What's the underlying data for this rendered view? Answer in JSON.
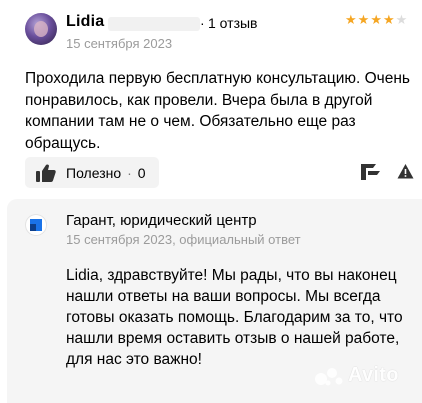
{
  "review": {
    "author": "Lidia",
    "reviews_count": "1 отзыв",
    "rating": 4,
    "max_rating": 5,
    "date": "15 сентября 2023",
    "text": "Проходила первую бесплатную консультацию. Очень понравилось, как провели. Вчера была в другой компании там не о чем. Обязательно еще раз обращусь.",
    "useful_label": "Полезно",
    "useful_separator": "·",
    "useful_count": "0"
  },
  "reply": {
    "company": "Гарант, юридический центр",
    "meta": "15 сентября 2023, официальный ответ",
    "text": "Lidia, здравствуйте! Мы рады, что вы наконец нашли ответы на ваши вопросы. Мы всегда готовы оказать помощь. Благодарим за то, что нашли время оставить отзыв о нашей работе, для нас это важно!"
  },
  "watermark": {
    "text": "Avito"
  },
  "colors": {
    "star_filled": "#f5a623",
    "star_empty": "#dcdcdc",
    "company_logo": "#1a73e8"
  },
  "icons": [
    "avatar",
    "star-icon",
    "thumb-up-icon",
    "flag-icon",
    "warning-icon",
    "company-logo-icon",
    "avito-watermark-icon"
  ]
}
